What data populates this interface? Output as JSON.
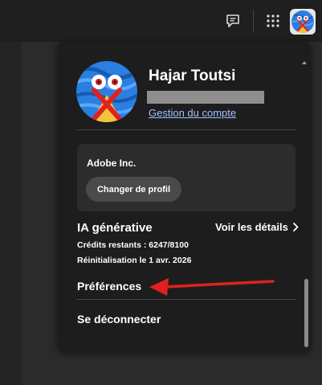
{
  "colors": {
    "panel_bg": "#1d1d1d",
    "card_bg": "#2c2c2c",
    "link": "#9fc3ff",
    "annotation_arrow": "#e0211d"
  },
  "topbar": {
    "icons": [
      "chat-icon",
      "apps-grid-icon",
      "profile-avatar"
    ]
  },
  "profile": {
    "name": "Hajar Toutsi",
    "manage_link": "Gestion du compte"
  },
  "organization": {
    "name": "Adobe Inc.",
    "switch_button": "Changer de profil"
  },
  "genai": {
    "title": "IA générative",
    "details_link": "Voir les détails",
    "credits": "Crédits restants : 6247/8100",
    "reset": "Réinitialisation le 1 avr. 2026"
  },
  "menu": {
    "preferences": "Préférences",
    "sign_out": "Se déconnecter"
  }
}
